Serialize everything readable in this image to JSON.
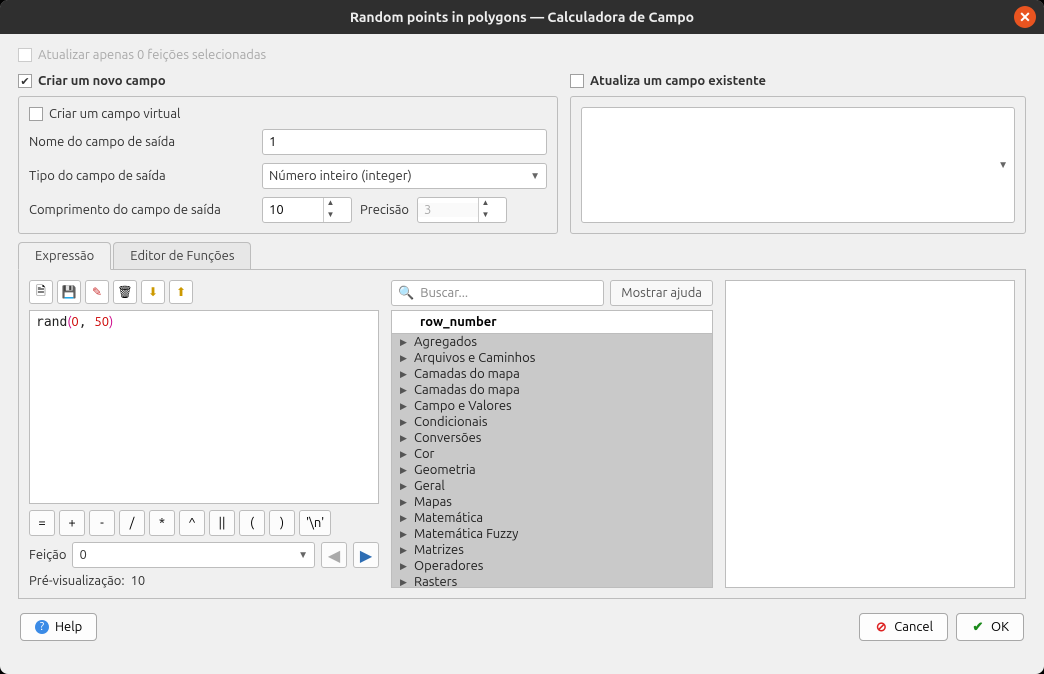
{
  "title": "Random points in polygons — Calculadora de Campo",
  "top_checkbox": {
    "label": "Atualizar apenas 0 feições selecionadas",
    "checked": false,
    "enabled": false
  },
  "left": {
    "create_new": {
      "label": "Criar um novo campo",
      "checked": true
    },
    "virtual": {
      "label": "Criar um campo virtual",
      "checked": false
    },
    "fields": {
      "name_label": "Nome do campo de saída",
      "name_value": "1",
      "type_label": "Tipo do campo de saída",
      "type_value": "Número inteiro (integer)",
      "len_label": "Comprimento do campo de saída",
      "len_value": "10",
      "prec_label": "Precisão",
      "prec_value": "3"
    }
  },
  "right": {
    "update": {
      "label": "Atualiza um campo existente",
      "checked": false
    },
    "combo_value": ""
  },
  "tabs": {
    "expr": "Expressão",
    "func": "Editor de Funções"
  },
  "toolbar_icons": [
    "new",
    "save",
    "edit",
    "delete",
    "import",
    "export"
  ],
  "expression_html": "rand<span class='paren'>(</span><span class='num'>0</span>, <span class='num'>50</span><span class='paren'>)</span>",
  "ops": [
    "=",
    "+",
    "-",
    "/",
    "*",
    "^",
    "||",
    "(",
    ")",
    "'\\n'"
  ],
  "feature": {
    "label": "Feição",
    "value": "0"
  },
  "preview": {
    "label": "Pré-visualização:",
    "value": "10"
  },
  "search_placeholder": "Buscar...",
  "show_help": "Mostrar ajuda",
  "tree_header": "row_number",
  "tree_items": [
    "Agregados",
    "Arquivos e Caminhos",
    "Camadas do mapa",
    "Camadas do mapa",
    "Campo e Valores",
    "Condicionais",
    "Conversões",
    "Cor",
    "Geometria",
    "Geral",
    "Mapas",
    "Matemática",
    "Matemática Fuzzy",
    "Matrizes",
    "Operadores",
    "Rasters"
  ],
  "footer": {
    "help": "Help",
    "cancel": "Cancel",
    "ok": "OK"
  }
}
